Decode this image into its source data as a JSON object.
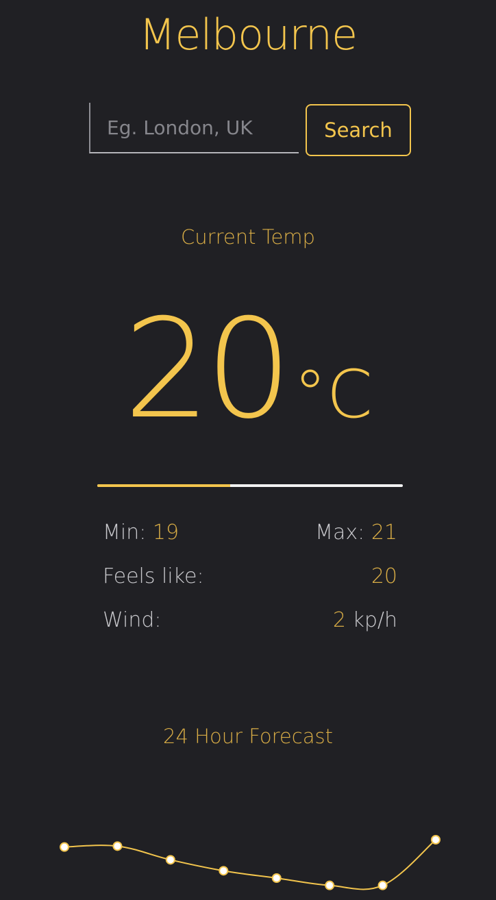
{
  "city": "Melbourne",
  "search": {
    "placeholder": "Eg. London, UK",
    "value": "",
    "button_label": "Search"
  },
  "current": {
    "label": "Current Temp",
    "temp": "20",
    "unit": "°C",
    "bar_fraction": 0.435
  },
  "stats": {
    "min_label": "Min:",
    "min_value": "19",
    "max_label": "Max:",
    "max_value": "21",
    "feels_label": "Feels like:",
    "feels_value": "20",
    "wind_label": "Wind:",
    "wind_value": "2",
    "wind_unit": "kp/h"
  },
  "forecast": {
    "label": "24 Hour Forecast"
  },
  "colors": {
    "background": "#202024",
    "accent": "#f3c54d",
    "muted_accent": "#d9ad46",
    "text": "#c9c9cd"
  },
  "chart_data": {
    "type": "line",
    "values": [
      20.7,
      20.75,
      20.0,
      19.4,
      19.0,
      18.6,
      18.6,
      21.1
    ],
    "ylim": [
      17.8,
      22.0
    ]
  }
}
